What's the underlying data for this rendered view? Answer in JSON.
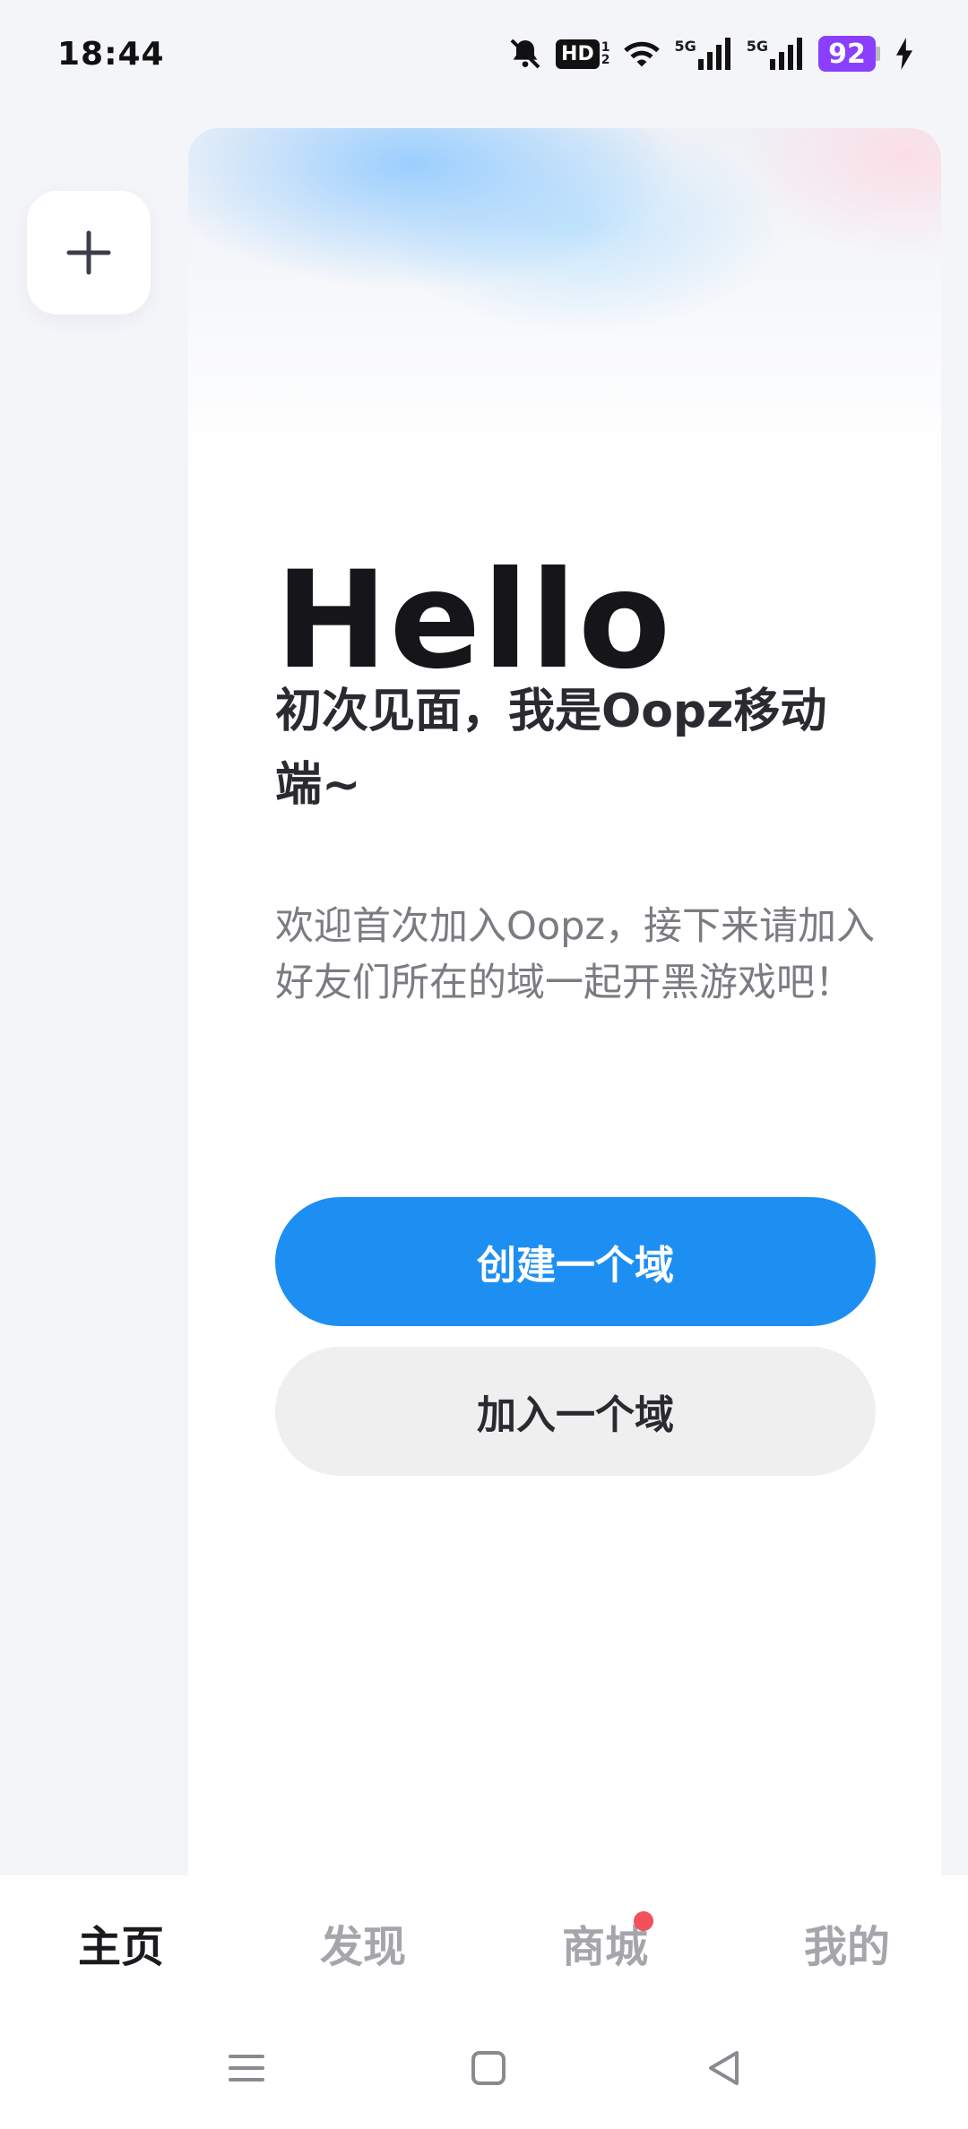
{
  "status_bar": {
    "time": "18:44",
    "battery_level": "92",
    "hd_label": "HD",
    "signal_label_1": "5G",
    "signal_label_2": "5G"
  },
  "side_rail": {
    "add_button_icon": "plus-icon"
  },
  "welcome": {
    "title": "Hello",
    "heading": "初次见面，我是Oopz移动端~",
    "body": "欢迎首次加入Oopz，接下来请加入好友们所在的域一起开黑游戏吧！"
  },
  "actions": {
    "create_label": "创建一个域",
    "join_label": "加入一个域"
  },
  "tabs": [
    {
      "label": "主页",
      "active": true
    },
    {
      "label": "发现",
      "active": false
    },
    {
      "label": "商城",
      "active": false,
      "badge": true
    },
    {
      "label": "我的",
      "active": false
    }
  ],
  "colors": {
    "accent": "#1e8ff2",
    "battery": "#8a3ffc",
    "badge": "#f2505a"
  },
  "system_nav_icons": [
    "menu-icon",
    "home-square-icon",
    "back-triangle-icon"
  ]
}
